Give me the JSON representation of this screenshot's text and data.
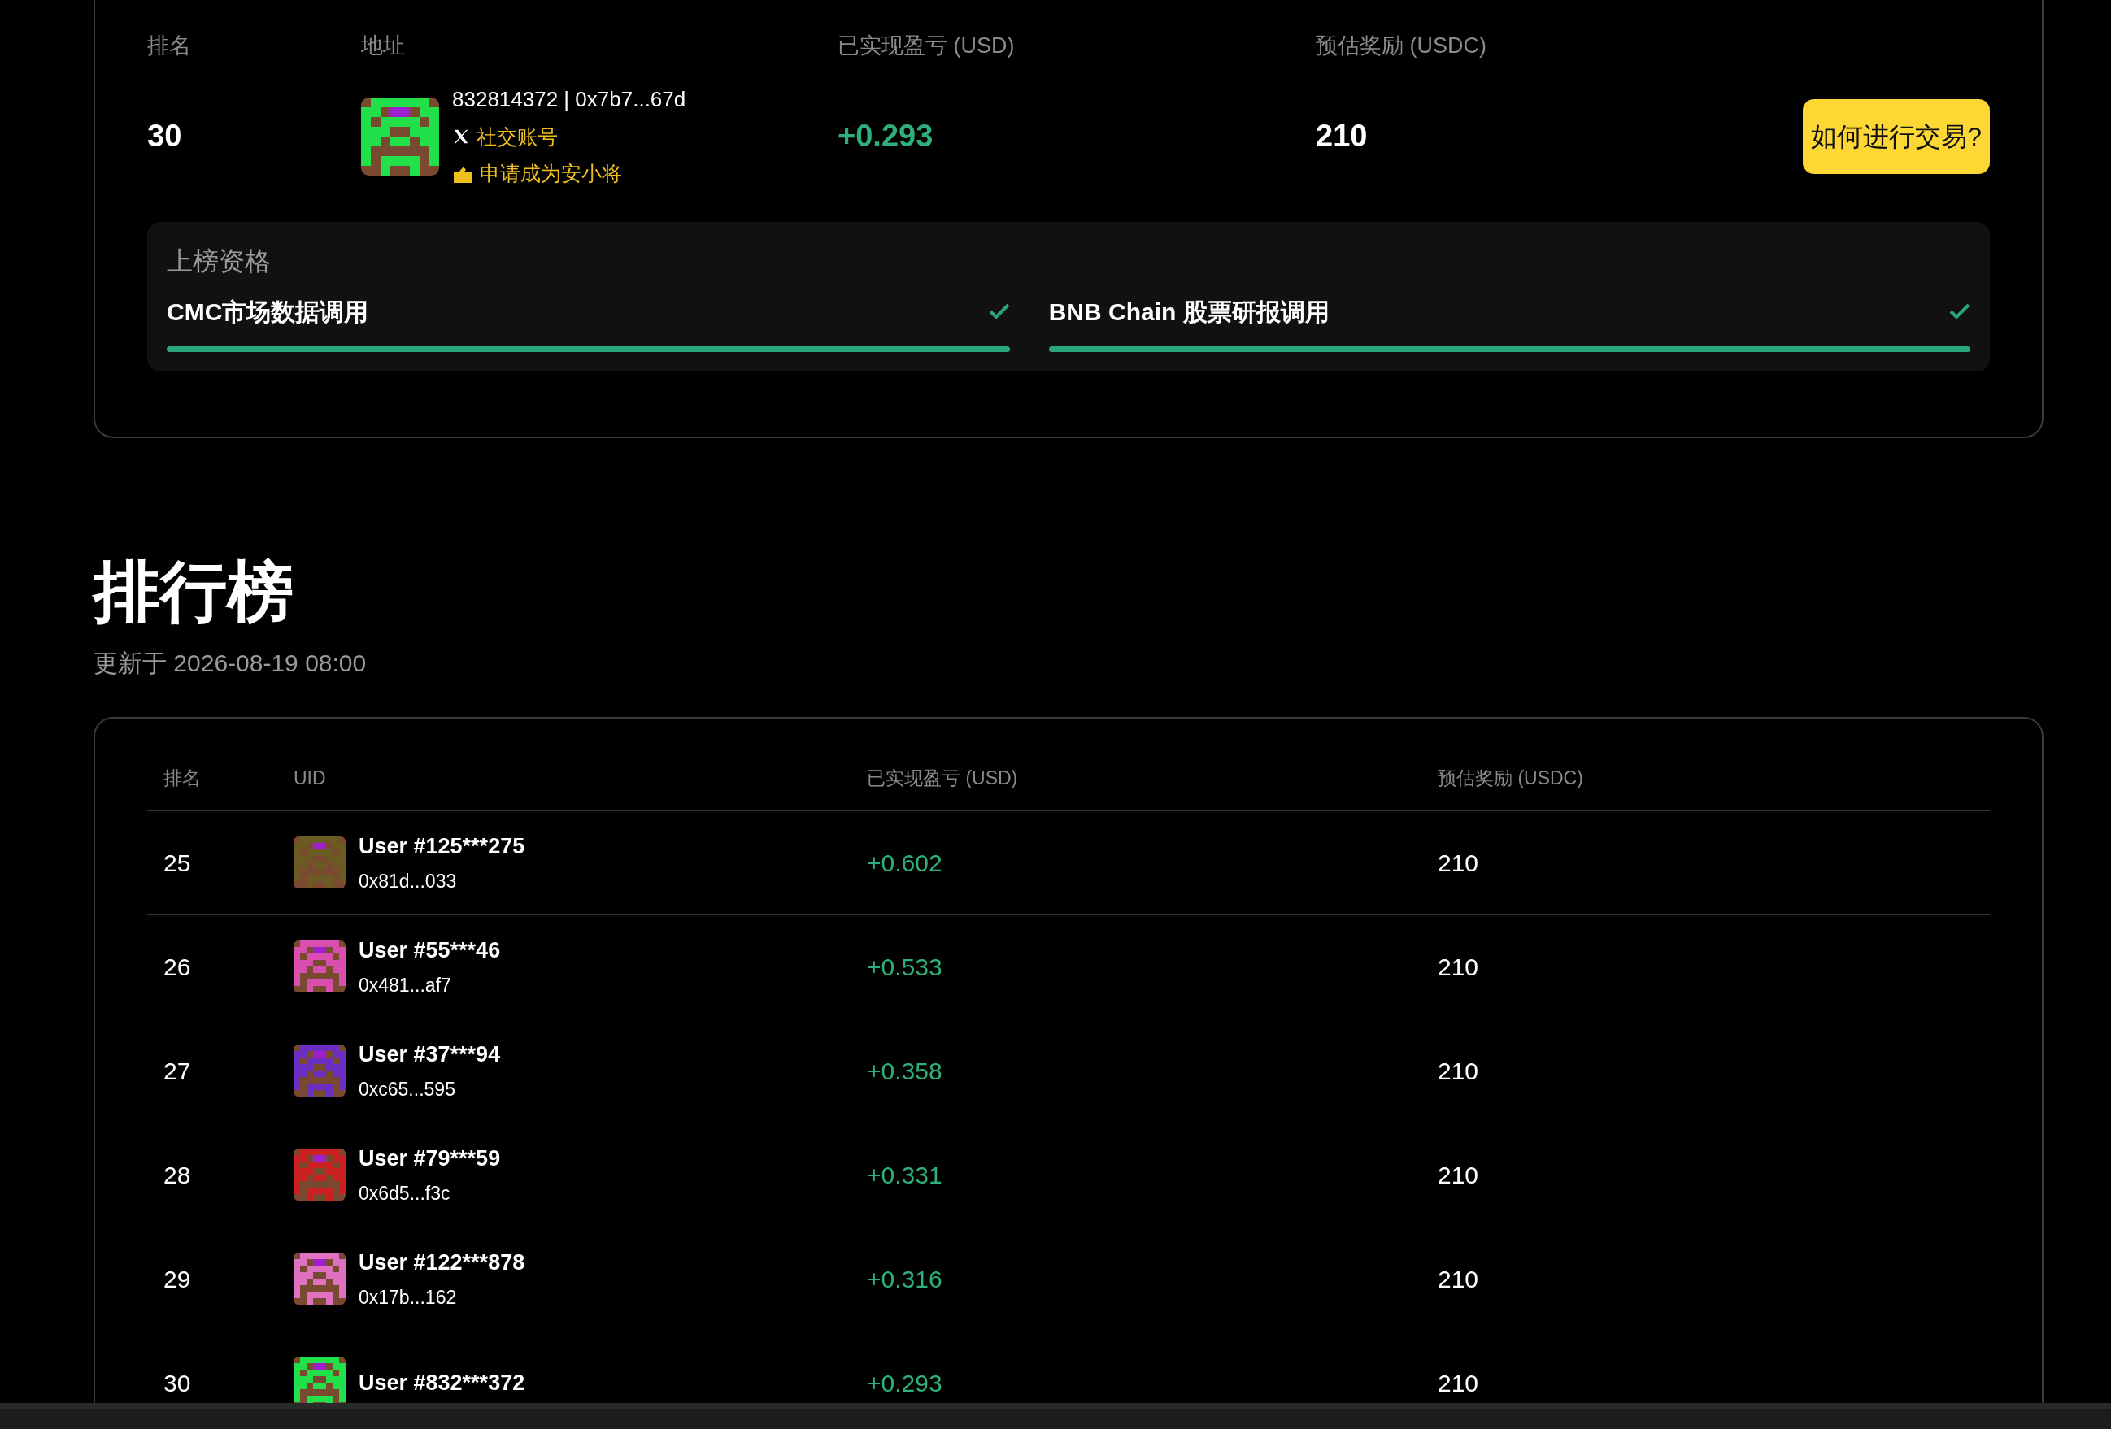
{
  "my_entry": {
    "columns": [
      "排名",
      "地址",
      "已实现盈亏 (USD)",
      "预估奖励 (USDC)"
    ],
    "rank": "30",
    "address": "832814372 | 0x7b7...67d",
    "social_link": "社交账号",
    "apply_link": "申请成为安小将",
    "pnl": "+0.293",
    "reward": "210",
    "color": "#22e04a",
    "help_button": "如何进行交易?"
  },
  "qualification": {
    "title": "上榜资格",
    "items": [
      {
        "label": "CMC市场数据调用",
        "checked": true,
        "level": 1
      },
      {
        "label": "BNB Chain 股票研报调用",
        "checked": true,
        "level": 1
      }
    ]
  },
  "leaderboard": {
    "title": "排行榜",
    "updated": "更新于 2026-08-19 08:00",
    "columns": [
      "排名",
      "UID",
      "已实现盈亏 (USD)",
      "预估奖励 (USDC)"
    ],
    "rows": [
      {
        "rank": "25",
        "user": "User #125***275",
        "address": "0x81d...033",
        "pnl": "+0.602",
        "reward": "210",
        "color": "#6b5a22"
      },
      {
        "rank": "26",
        "user": "User #55***46",
        "address": "0x481...af7",
        "pnl": "+0.533",
        "reward": "210",
        "color": "#d94fb0"
      },
      {
        "rank": "27",
        "user": "User #37***94",
        "address": "0xc65...595",
        "pnl": "+0.358",
        "reward": "210",
        "color": "#6a2fc0"
      },
      {
        "rank": "28",
        "user": "User #79***59",
        "address": "0x6d5...f3c",
        "pnl": "+0.331",
        "reward": "210",
        "color": "#cc2020"
      },
      {
        "rank": "29",
        "user": "User #122***878",
        "address": "0x17b...162",
        "pnl": "+0.316",
        "reward": "210",
        "color": "#e070c0"
      },
      {
        "rank": "30",
        "user": "User #832***372",
        "pnl": "+0.293",
        "reward": "210",
        "color": "#22e04a"
      }
    ]
  }
}
